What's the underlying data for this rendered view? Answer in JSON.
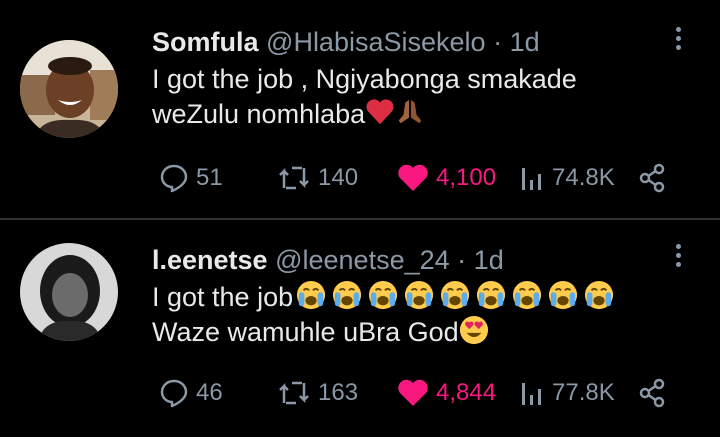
{
  "tweets": [
    {
      "name": "Somfula",
      "handle": "@HlabisaSisekelo",
      "separator": "·",
      "time": "1d",
      "line1": "I got the job , Ngiyabonga smakade",
      "line2": "weZulu nomhlaba",
      "line2_emoji": [
        "red-heart",
        "folded-hands"
      ],
      "replies": "51",
      "retweets": "140",
      "likes": "4,100",
      "views": "74.8K"
    },
    {
      "name": "l.eenetse",
      "handle": "@leenetse_24",
      "separator": "·",
      "time": "1d",
      "line1": "I got the job",
      "line1_emoji_count": 9,
      "line1_emoji": "loudly-crying-face",
      "line2": "Waze wamuhle uBra God",
      "line2_emoji": [
        "heart-eyes-face"
      ],
      "replies": "46",
      "retweets": "163",
      "likes": "4,844",
      "views": "77.8K"
    }
  ],
  "colors": {
    "background": "#000000",
    "text": "#e7e9ea",
    "muted": "#8b98a5",
    "like": "#f91880",
    "divider": "#2f3336"
  }
}
